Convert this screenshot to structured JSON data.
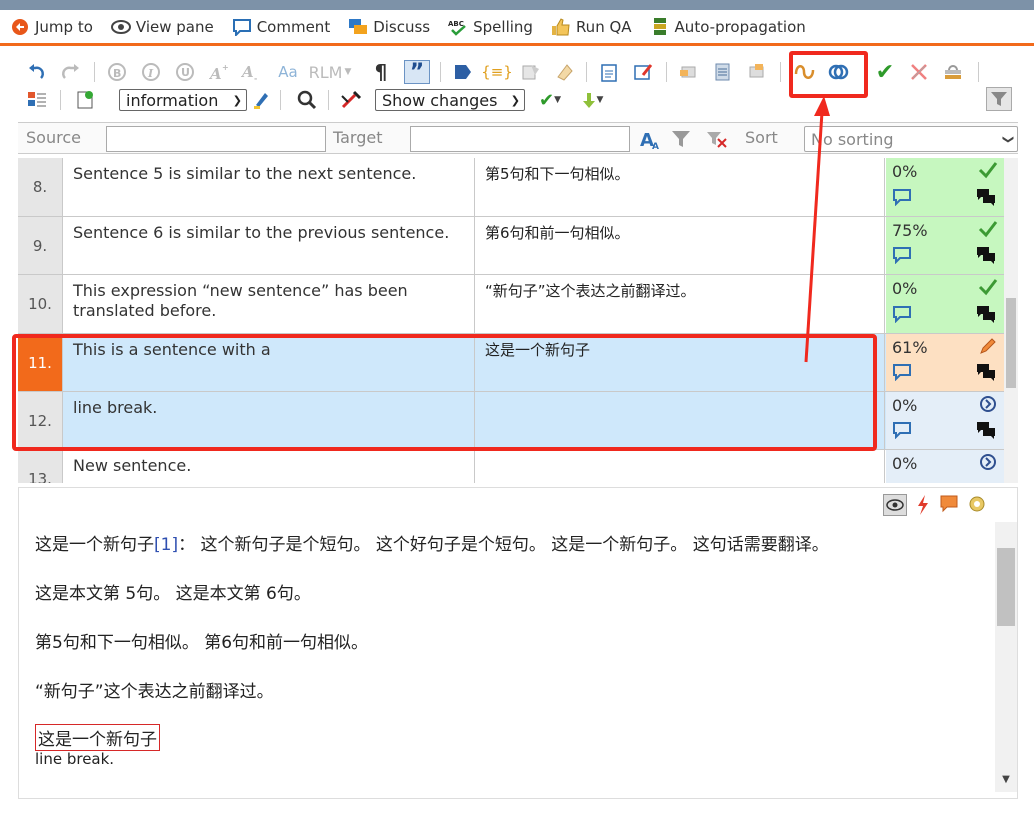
{
  "ribbon": {
    "jump_to": "Jump to",
    "view_pane": "View pane",
    "comment": "Comment",
    "discuss": "Discuss",
    "spelling": "Spelling",
    "run_qa": "Run QA",
    "auto_propagation": "Auto-propagation"
  },
  "toolbar": {
    "rlm": "RLM",
    "aa": "Aa",
    "info_dropdown": "information",
    "changes_dropdown": "Show changes"
  },
  "filter": {
    "source_label": "Source",
    "target_label": "Target",
    "sort_label": "Sort",
    "sort_value": "No sorting"
  },
  "segments": [
    {
      "num": "8.",
      "source": "Sentence 5 is similar to the next sentence.",
      "target": "第5句和下一句相似。",
      "percent": "0%"
    },
    {
      "num": "9.",
      "source": "Sentence 6 is similar to the previous sentence.",
      "target": "第6句和前一句相似。",
      "percent": "75%"
    },
    {
      "num": "10.",
      "source": "This expression “new sentence” has been translated before.",
      "target": "“新句子”这个表达之前翻译过。",
      "percent": "0%"
    },
    {
      "num": "11.",
      "source": "This is a sentence with a",
      "target": "这是一个新句子",
      "percent": "61%"
    },
    {
      "num": "12.",
      "source": "line break.",
      "target": "",
      "percent": "0%"
    },
    {
      "num": "13.",
      "source": "New sentence.",
      "target": "",
      "percent": "0%"
    }
  ],
  "preview": {
    "line1_a": "这是一个新句子",
    "line1_ref": "[1]",
    "line1_b": "：  这个新句子是个短句。 这个好句子是个短句。 这是一个新句子。 这句话需要翻译。",
    "line2": "这是本文第 5句。 这是本文第 6句。",
    "line3": "第5句和下一句相似。 第6句和前一句相似。",
    "line4": "“新句子”这个表达之前翻译过。",
    "line5_boxed": "这是一个新句子",
    "line6": "line break."
  },
  "colors": {
    "accent_orange": "#f26a1b",
    "highlight_red": "#f0291e",
    "selected_row": "#cfe8fb",
    "confirmed_green": "#c6f7bf",
    "edited_orange": "#fde0c2"
  }
}
